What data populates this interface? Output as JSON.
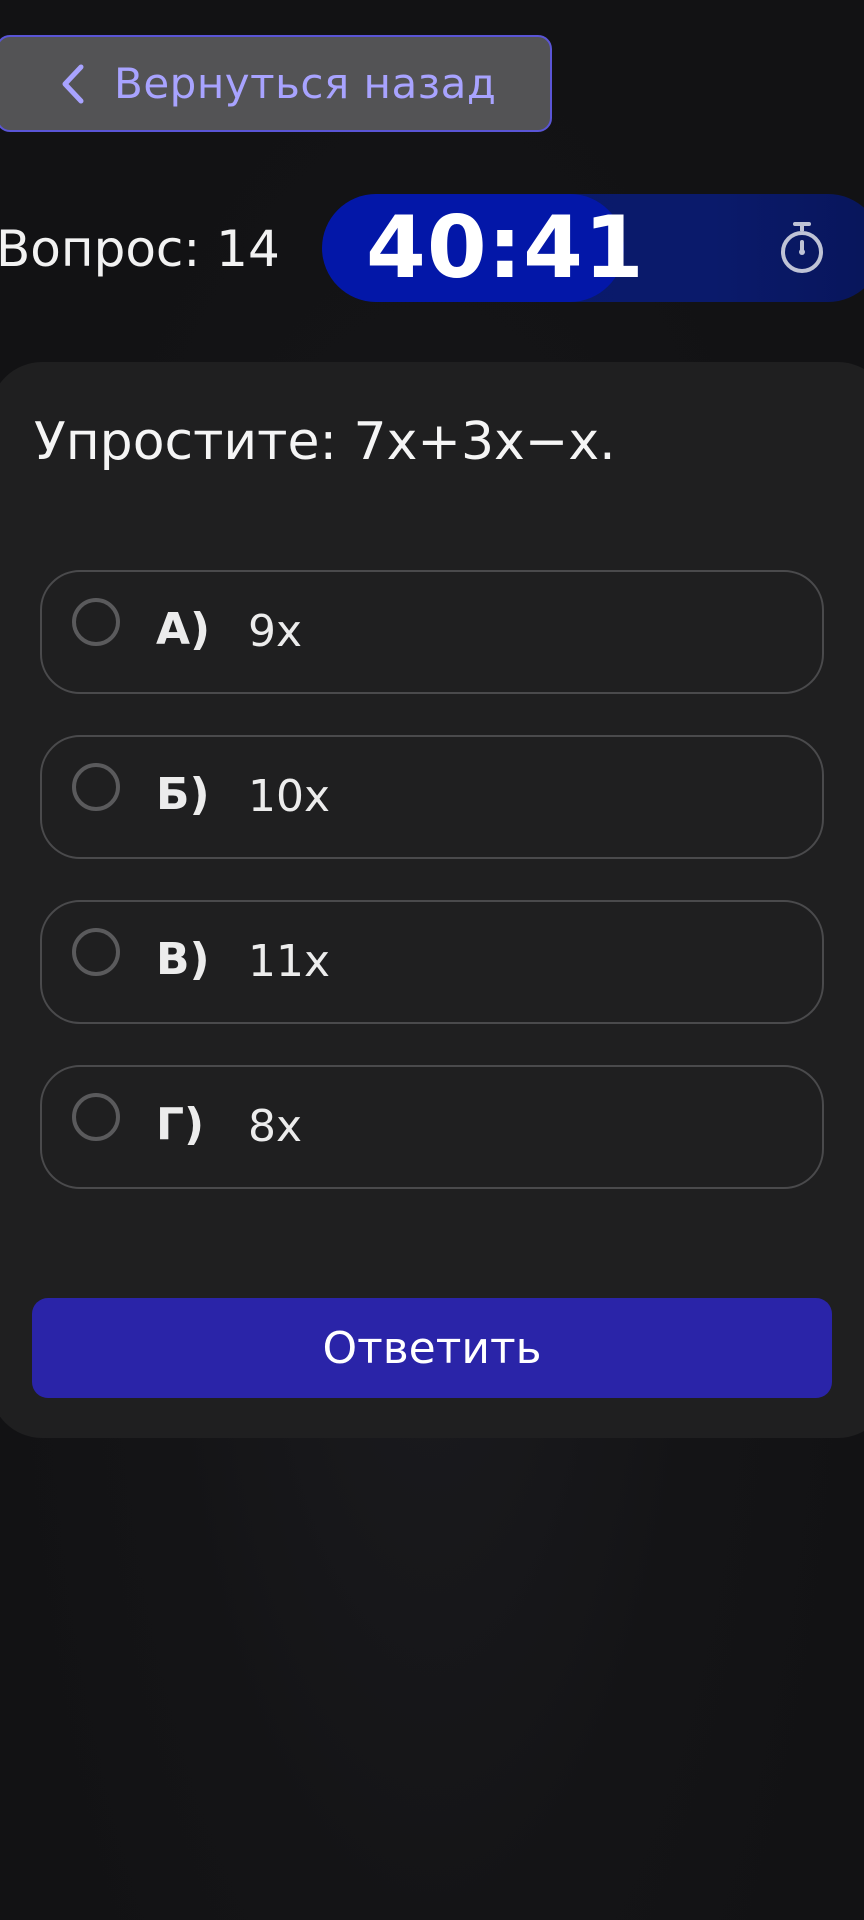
{
  "header": {
    "back_label": "Вернуться назад"
  },
  "quiz": {
    "question_number_text": "Вопрос: 14",
    "timer_value": "40:41",
    "timer_remaining_fraction": 0.54,
    "question_text": "Упростите: 7x+3x−x.",
    "options": [
      {
        "letter": "А)",
        "text": "9x"
      },
      {
        "letter": "Б)",
        "text": "10x"
      },
      {
        "letter": "В)",
        "text": "11x"
      },
      {
        "letter": "Г)",
        "text": "8x"
      }
    ],
    "submit_label": "Ответить"
  },
  "icons": {
    "back": "chevron-left-icon",
    "timer": "stopwatch-icon"
  },
  "colors": {
    "accent": "#a8a3ff",
    "timer_fill": "#0317a8",
    "submit": "#2a24a8",
    "card": "#1f1f20",
    "background": "#121214"
  }
}
